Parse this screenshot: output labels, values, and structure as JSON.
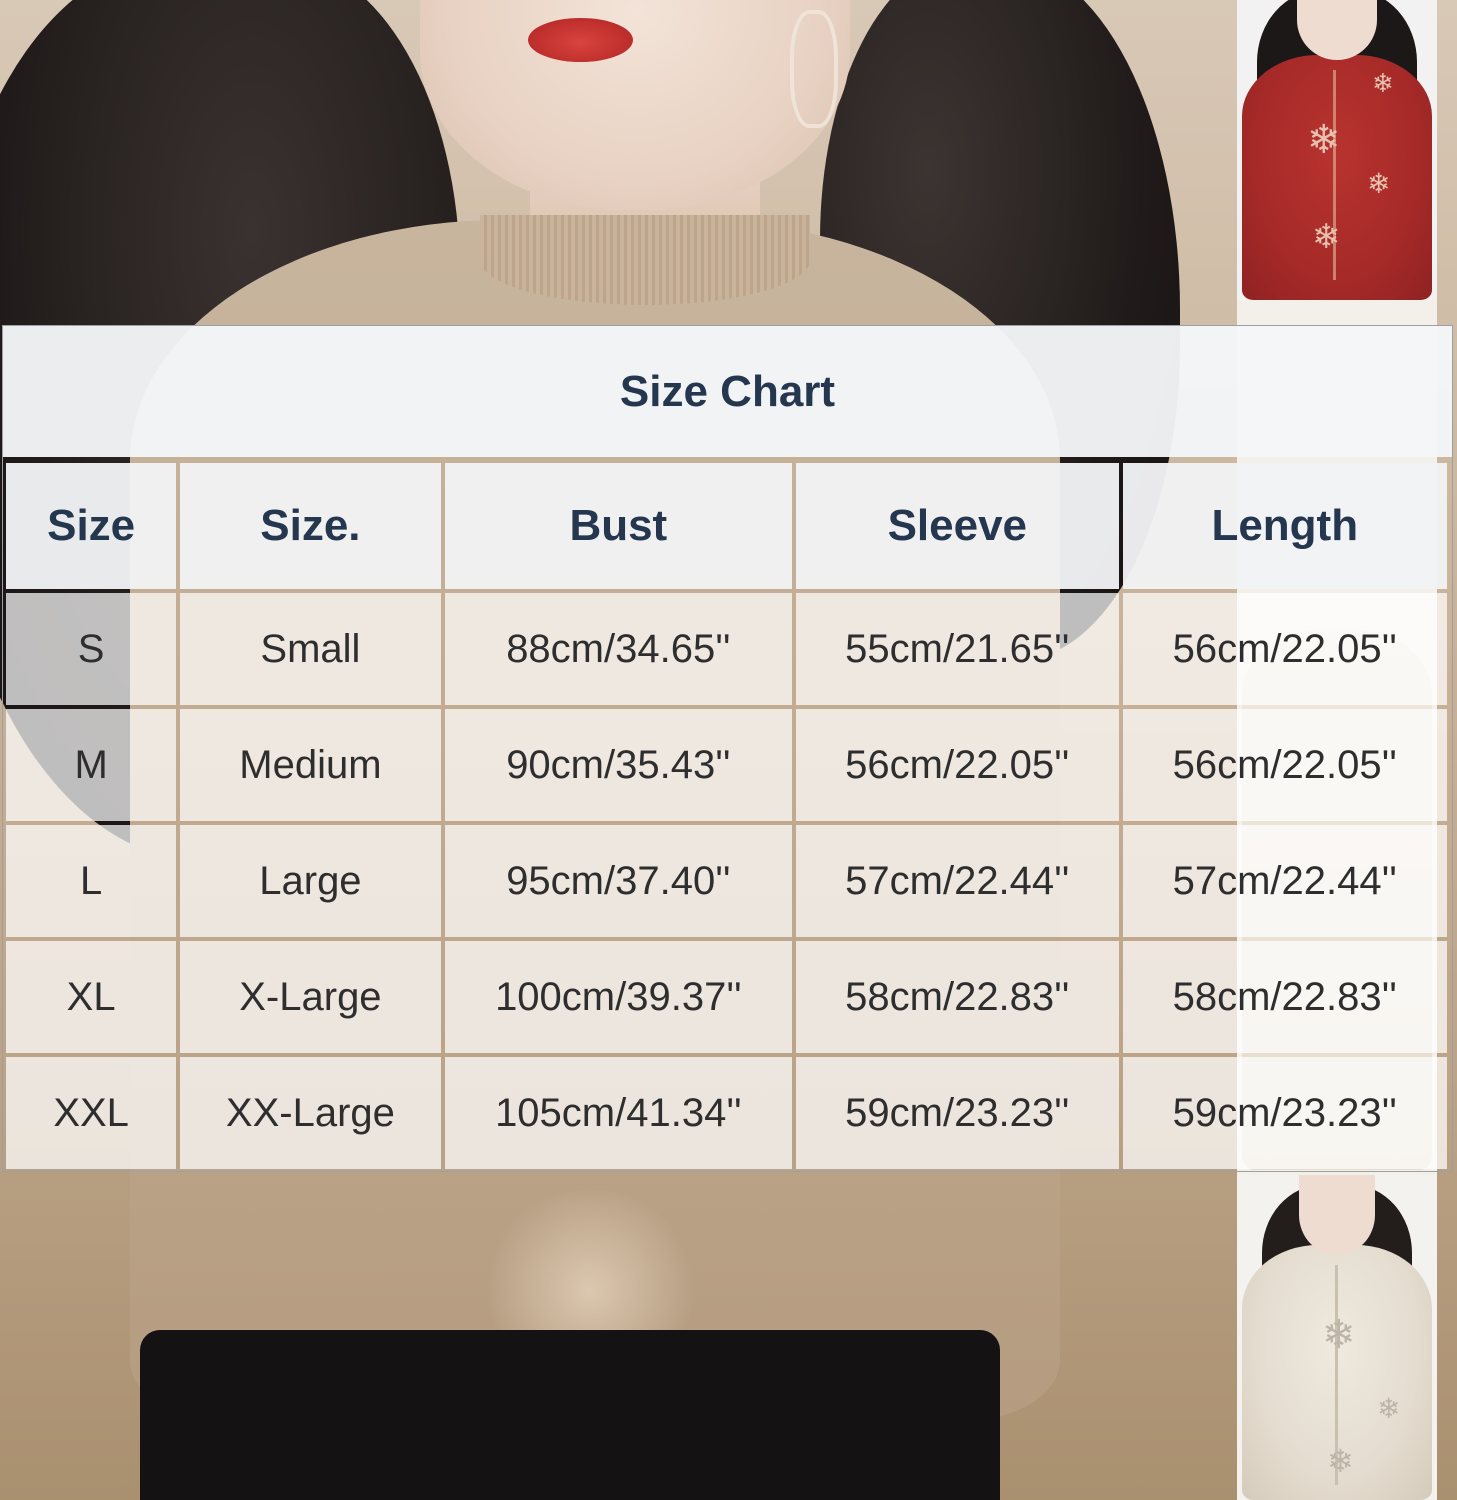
{
  "chart_data": {
    "type": "table",
    "title": "Size Chart",
    "columns": [
      "Size",
      "Size.",
      "Bust",
      "Sleeve",
      "Length"
    ],
    "rows": [
      [
        "S",
        "Small",
        "88cm/34.65''",
        "55cm/21.65''",
        "56cm/22.05''"
      ],
      [
        "M",
        "Medium",
        "90cm/35.43''",
        "56cm/22.05''",
        "56cm/22.05''"
      ],
      [
        "L",
        "Large",
        "95cm/37.40''",
        "57cm/22.44''",
        "57cm/22.44''"
      ],
      [
        "XL",
        "X-Large",
        "100cm/39.37''",
        "58cm/22.83''",
        "58cm/22.83''"
      ],
      [
        "XXL",
        "XX-Large",
        "105cm/41.34''",
        "59cm/23.23''",
        "59cm/23.23''"
      ]
    ]
  },
  "colors": {
    "header_text": "#25364f",
    "cell_text": "#2e2e2e",
    "thumbnail_red_sweater": "#a62a28",
    "thumbnail_white_sweater": "#e4dccf",
    "main_sweater": "#c2ac92"
  }
}
